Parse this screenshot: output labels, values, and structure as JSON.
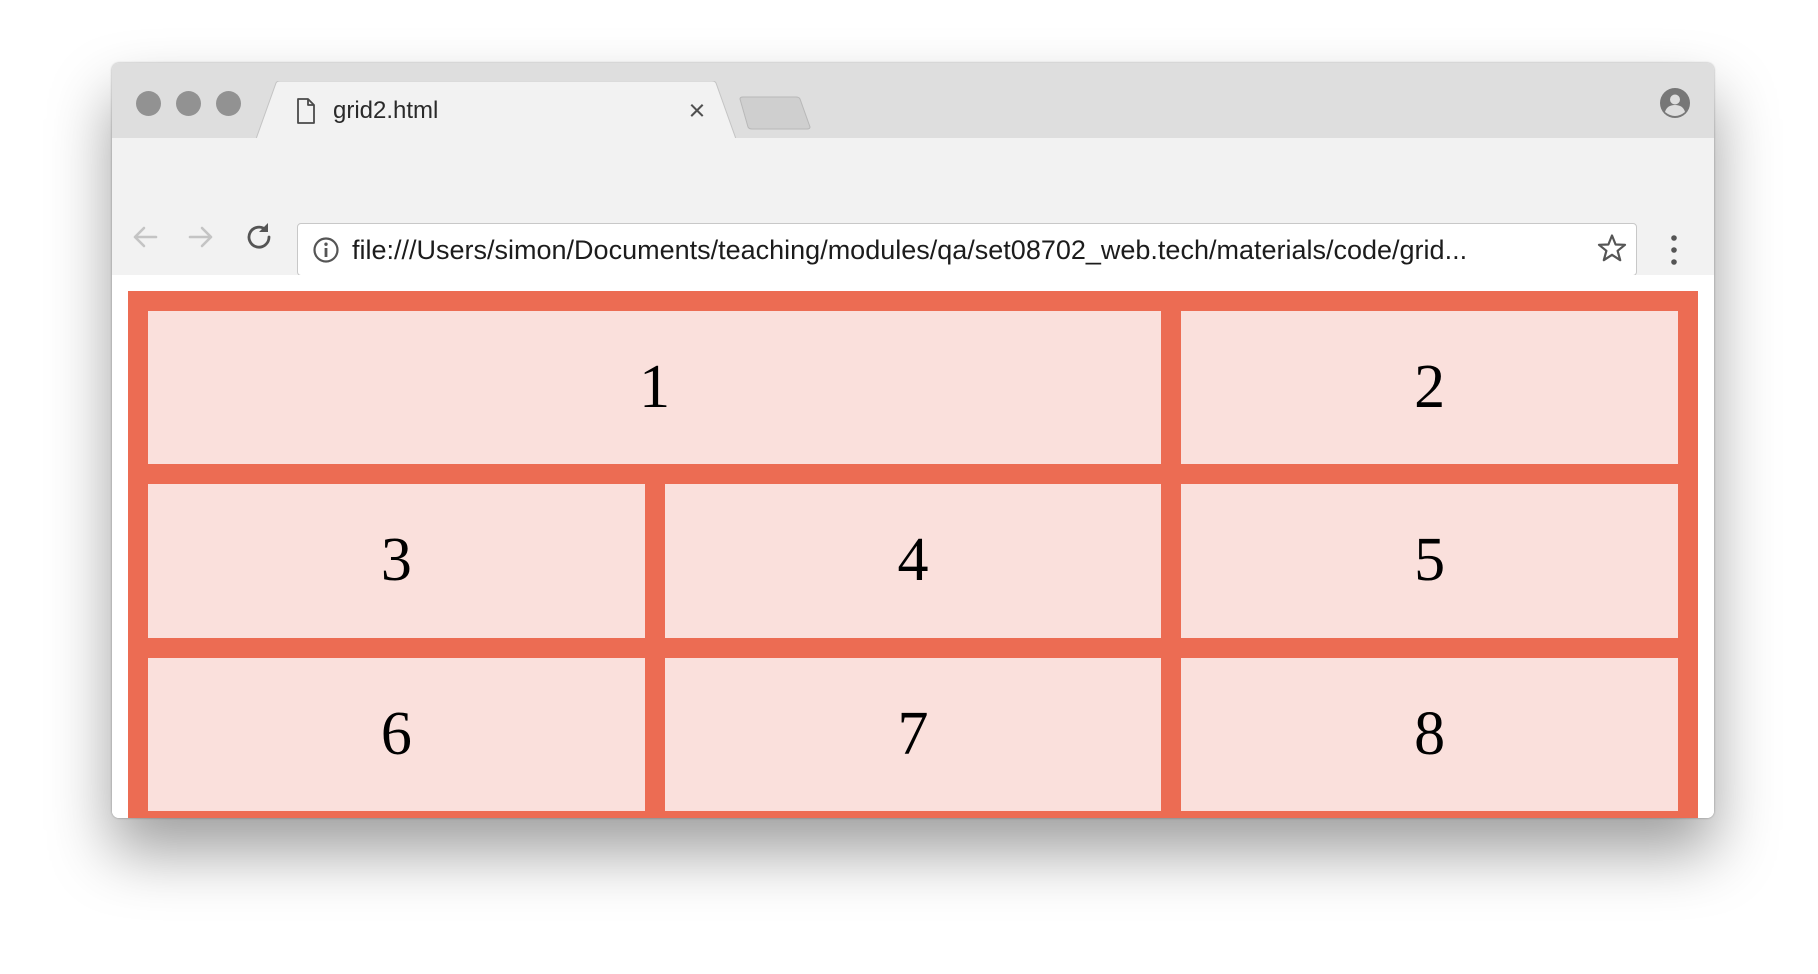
{
  "browser": {
    "tab": {
      "title": "grid2.html"
    },
    "address_bar": {
      "url": "file:///Users/simon/Documents/teaching/modules/qa/set08702_web.tech/materials/code/grid..."
    },
    "colors": {
      "tabstrip": "#dedede",
      "toolbar": "#f2f2f2"
    }
  },
  "page": {
    "colors": {
      "grid_background": "#ec6c53",
      "cell_background": "#fae0dc"
    },
    "grid_items": [
      "1",
      "2",
      "3",
      "4",
      "5",
      "6",
      "7",
      "8"
    ]
  }
}
